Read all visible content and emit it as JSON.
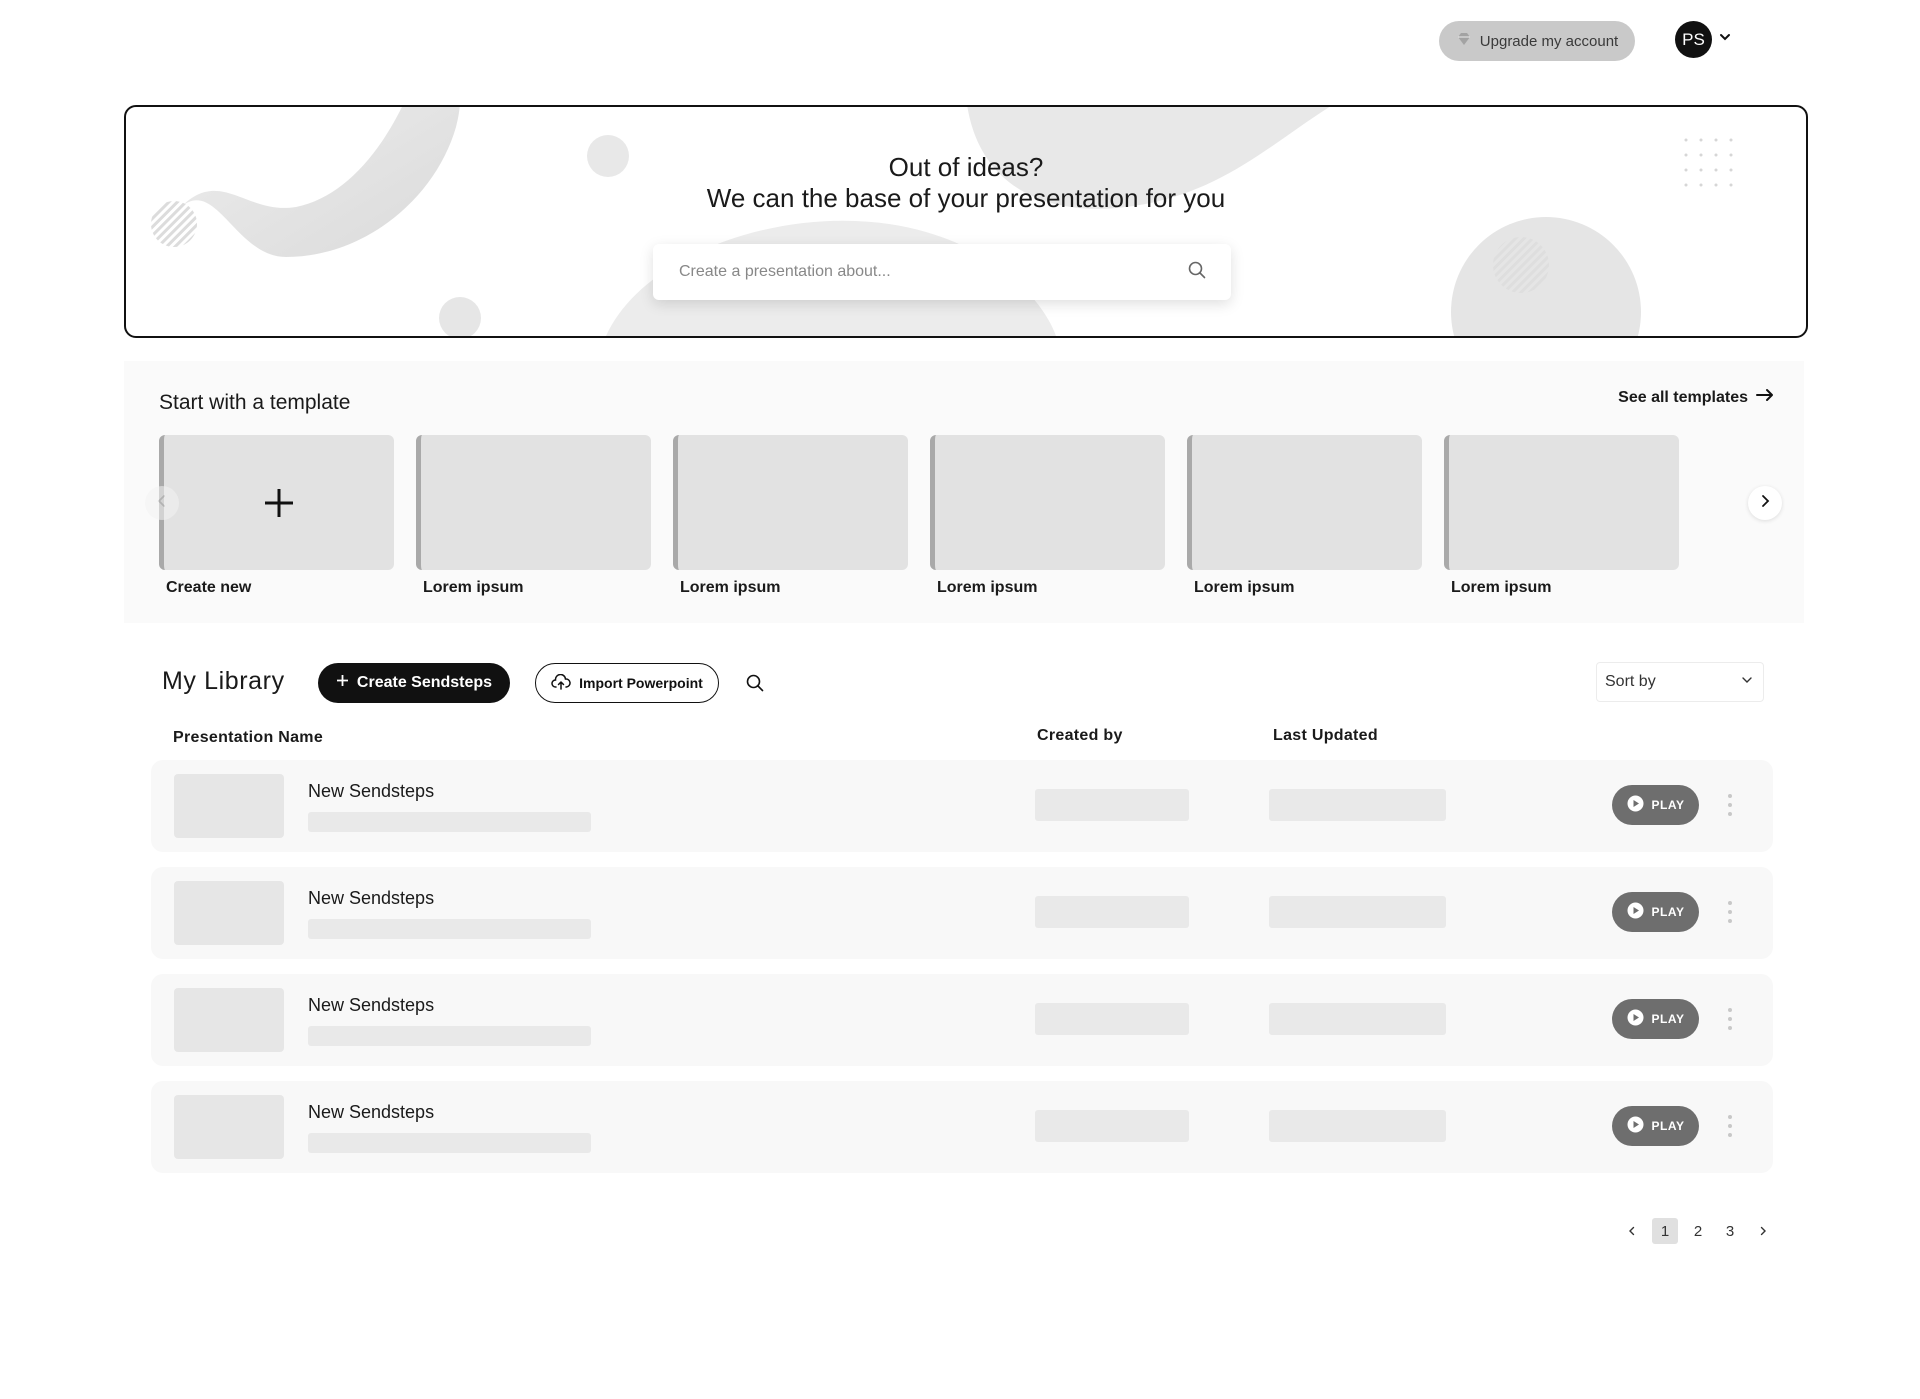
{
  "topbar": {
    "upgrade_label": "Upgrade my account",
    "avatar_initials": "PS"
  },
  "hero": {
    "title_line1": "Out of ideas?",
    "title_line2": "We can the base of your presentation for you",
    "search_placeholder": "Create a presentation about..."
  },
  "templates": {
    "heading": "Start with a template",
    "see_all_label": "See all templates",
    "items": [
      {
        "label": "Create new"
      },
      {
        "label": "Lorem ipsum"
      },
      {
        "label": "Lorem ipsum"
      },
      {
        "label": "Lorem ipsum"
      },
      {
        "label": "Lorem ipsum"
      },
      {
        "label": "Lorem ipsum"
      }
    ]
  },
  "library": {
    "title": "My Library",
    "create_label": "Create Sendsteps",
    "import_label": "Import Powerpoint",
    "sort_label": "Sort by",
    "columns": {
      "name": "Presentation Name",
      "created_by": "Created by",
      "last_updated": "Last Updated"
    },
    "rows": [
      {
        "name": "New Sendsteps",
        "play_label": "PLAY"
      },
      {
        "name": "New Sendsteps",
        "play_label": "PLAY"
      },
      {
        "name": "New Sendsteps",
        "play_label": "PLAY"
      },
      {
        "name": "New Sendsteps",
        "play_label": "PLAY"
      }
    ]
  },
  "pagination": {
    "pages": [
      "1",
      "2",
      "3"
    ],
    "current": "1"
  },
  "colors": {
    "primary_button": "#111111",
    "play_button": "#6e6e6e",
    "upgrade_button": "#c9c9c9"
  }
}
